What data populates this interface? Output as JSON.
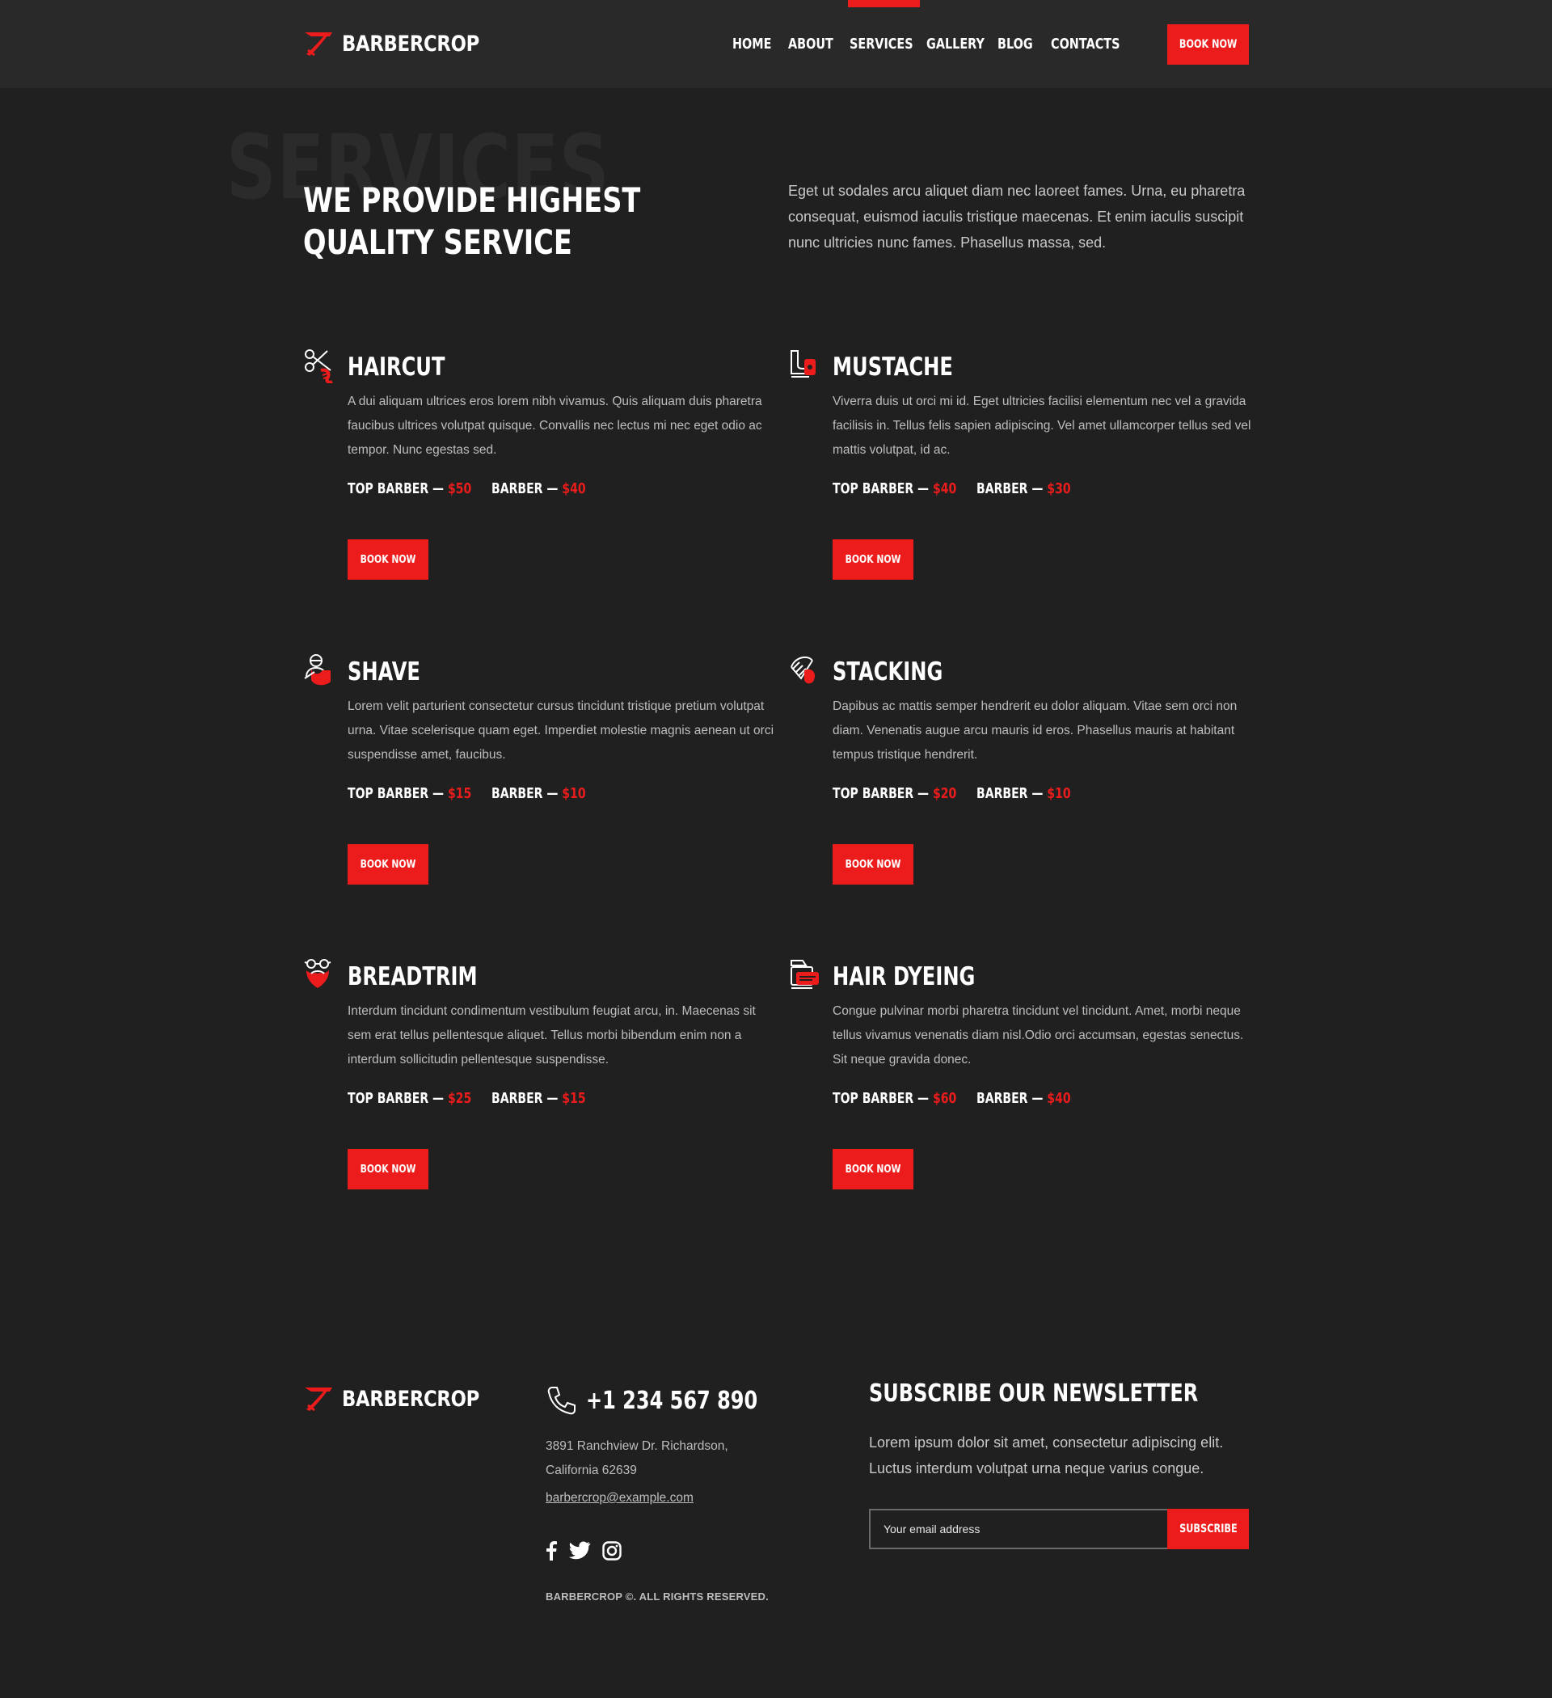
{
  "brand": {
    "name": "BARBERCROP",
    "accent": "#ec1c1c"
  },
  "nav": {
    "items": [
      {
        "label": "HOME"
      },
      {
        "label": "ABOUT"
      },
      {
        "label": "SERVICES",
        "active": true
      },
      {
        "label": "GALLERY"
      },
      {
        "label": "BLOG"
      },
      {
        "label": "CONTACTS"
      }
    ],
    "book_label": "BOOK NOW"
  },
  "hero": {
    "ghost": "SERVICES",
    "title": "WE PROVIDE HIGHEST QUALITY SERVICE",
    "text": "Eget ut sodales arcu aliquet diam nec laoreet fames. Urna, eu pharetra consequat, euismod iaculis tristique maecenas. Et enim iaculis suscipit nunc ultricies nunc fames. Phasellus massa, sed."
  },
  "services": [
    {
      "icon": "scissors-comb-icon",
      "title": "HAIRCUT",
      "desc": "A dui aliquam ultrices eros lorem nibh vivamus. Quis aliquam duis pharetra faucibus ultrices volutpat quisque. Convallis nec lectus mi nec eget odio ac tempor. Nunc egestas sed.",
      "top_label": "TOP BARBER — ",
      "top_price": "$50",
      "barber_label": "BARBER — ",
      "barber_price": "$40",
      "book": "BOOK NOW"
    },
    {
      "icon": "mustache-icon",
      "title": "MUSTACHE",
      "desc": "Viverra duis ut orci mi id. Eget ultricies facilisi elementum nec vel a gravida facilisis in. Tellus felis sapien adipiscing. Vel amet ullamcorper tellus sed vel mattis volutpat, id ac.",
      "top_label": "TOP BARBER — ",
      "top_price": "$40",
      "barber_label": "BARBER — ",
      "barber_price": "$30",
      "book": "BOOK NOW"
    },
    {
      "icon": "shave-icon",
      "title": "SHAVE",
      "desc": "Lorem velit parturient consectetur cursus tincidunt tristique pretium volutpat urna. Vitae scelerisque quam eget. Imperdiet molestie magnis aenean ut orci suspendisse amet, faucibus.",
      "top_label": "TOP BARBER — ",
      "top_price": "$15",
      "barber_label": "BARBER — ",
      "barber_price": "$10",
      "book": "BOOK NOW"
    },
    {
      "icon": "styling-icon",
      "title": "STACKING",
      "desc": "Dapibus ac mattis semper hendrerit eu dolor aliquam. Vitae sem orci non diam. Venenatis augue arcu mauris id eros. Phasellus mauris at habitant tempus tristique hendrerit.",
      "top_label": "TOP BARBER — ",
      "top_price": "$20",
      "barber_label": "BARBER — ",
      "barber_price": "$10",
      "book": "BOOK NOW"
    },
    {
      "icon": "beard-glasses-icon",
      "title": "BREADTRIM",
      "desc": "Interdum tincidunt condimentum vestibulum feugiat arcu, in. Maecenas sit sem erat tellus pellentesque aliquet. Tellus morbi bibendum enim non a interdum sollicitudin pellentesque suspendisse.",
      "top_label": "TOP BARBER — ",
      "top_price": "$25",
      "barber_label": "BARBER — ",
      "barber_price": "$15",
      "book": "BOOK NOW"
    },
    {
      "icon": "hair-dye-icon",
      "title": "HAIR DYEING",
      "desc": "Congue pulvinar morbi pharetra tincidunt vel tincidunt. Amet, morbi neque tellus vivamus venenatis diam nisl.Odio orci accumsan, egestas senectus. Sit neque gravida donec.",
      "top_label": "TOP BARBER — ",
      "top_price": "$60",
      "barber_label": "BARBER — ",
      "barber_price": "$40",
      "book": "BOOK NOW"
    }
  ],
  "footer": {
    "brand": "BARBERCROP",
    "phone": "+1 234 567 890",
    "address_line1": "3891 Ranchview Dr. Richardson,",
    "address_line2": "California 62639",
    "email": "barbercrop@example.com",
    "social": [
      "facebook-icon",
      "twitter-icon",
      "instagram-icon"
    ],
    "copyright": "BARBERCROP ©. ALL RIGHTS RESERVED.",
    "newsletter": {
      "title": "SUBSCRIBE OUR NEWSLETTER",
      "text": "Lorem ipsum dolor sit amet, consectetur adipiscing elit. Luctus interdum volutpat urna neque varius congue.",
      "placeholder": "Your email address",
      "button": "SUBSCRIBE"
    }
  }
}
